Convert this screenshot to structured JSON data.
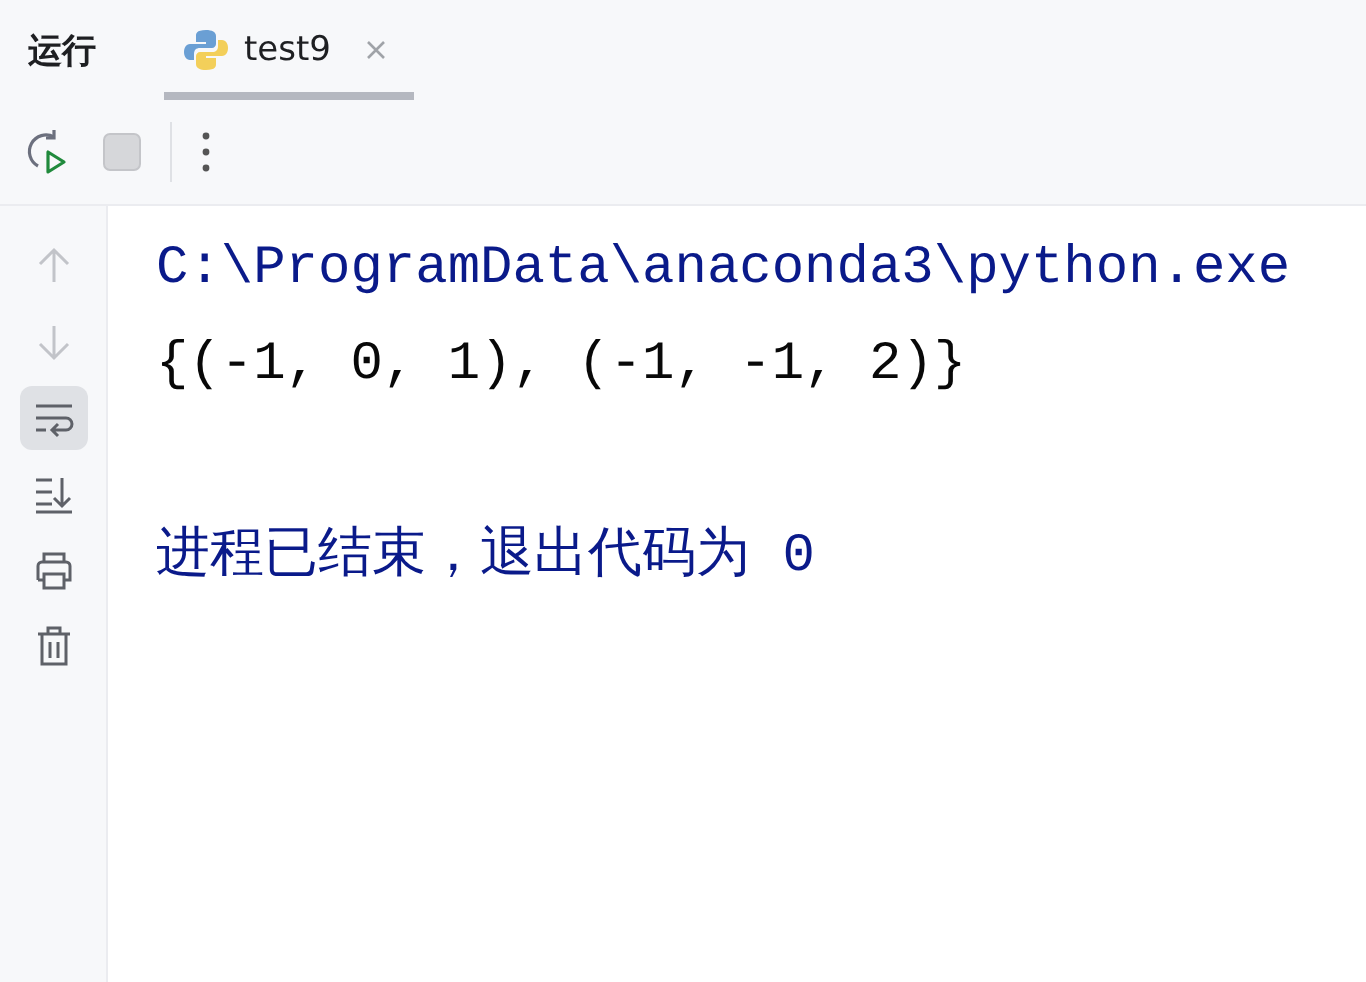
{
  "panel": {
    "title": "运行"
  },
  "tabs": [
    {
      "label": "test9",
      "selected": true,
      "closable": true
    }
  ],
  "toolbar": [
    {
      "kind": "rerun",
      "disabled": false
    },
    {
      "kind": "stop",
      "disabled": true
    },
    {
      "kind": "separator"
    },
    {
      "kind": "more"
    }
  ],
  "sidebar": {
    "items": [
      {
        "kind": "up",
        "disabled": true,
        "selected": false
      },
      {
        "kind": "down",
        "disabled": true,
        "selected": false
      },
      {
        "kind": "wrap",
        "disabled": false,
        "selected": true
      },
      {
        "kind": "scroll-end",
        "disabled": false,
        "selected": false
      },
      {
        "kind": "print",
        "disabled": false,
        "selected": false
      },
      {
        "kind": "trash",
        "disabled": false,
        "selected": false
      }
    ]
  },
  "console": {
    "lines": [
      {
        "kind": "system",
        "text": "C:\\ProgramData\\anaconda3\\python.exe"
      },
      {
        "kind": "stdout",
        "text": "{(-1, 0, 1), (-1, -1, 2)}"
      },
      {
        "kind": "blank"
      },
      {
        "kind": "system",
        "text": "进程已结束，退出代码为 0"
      }
    ]
  }
}
